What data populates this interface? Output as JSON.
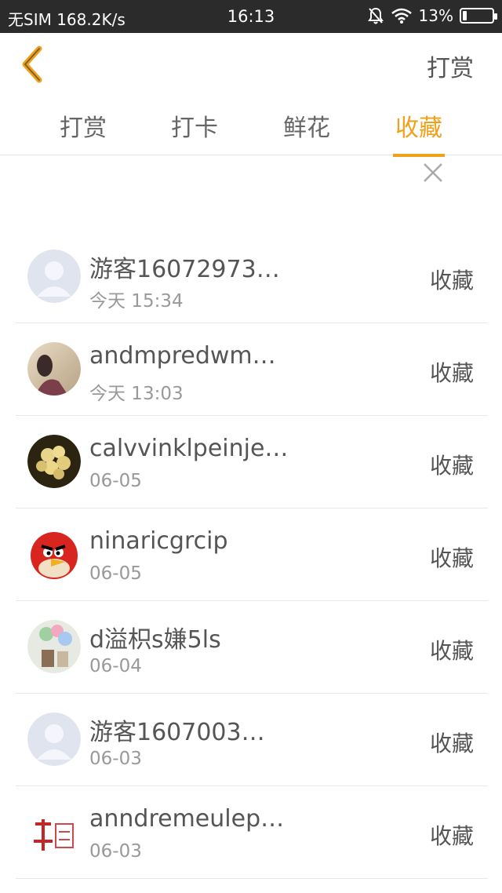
{
  "status_bar": {
    "carrier": "无SIM 168.2K/s",
    "time": "16:13",
    "battery_text": "13%",
    "battery_level": 0.13
  },
  "header": {
    "back_icon": "back-chevron-icon",
    "action_label": "打赏"
  },
  "tabs": [
    {
      "label": "打赏",
      "active": false
    },
    {
      "label": "打卡",
      "active": false
    },
    {
      "label": "鲜花",
      "active": false
    },
    {
      "label": "收藏",
      "active": true
    }
  ],
  "accent_color": "#f0a11c",
  "close_icon": "close-icon",
  "list": [
    {
      "name": "游客16072973…",
      "time": "今天 15:34",
      "action": "收藏",
      "avatar": "default-avatar"
    },
    {
      "name": "andmpredwm…",
      "time": "今天 13:03",
      "action": "收藏",
      "avatar": "photo-avatar"
    },
    {
      "name": "calvvinklpeinje…",
      "time": "06-05",
      "action": "收藏",
      "avatar": "flower-avatar"
    },
    {
      "name": "ninaricgrcip",
      "time": "06-05",
      "action": "收藏",
      "avatar": "angry-bird-avatar"
    },
    {
      "name": "d溢枳s嫌5ls",
      "time": "06-04",
      "action": "收藏",
      "avatar": "balloon-avatar"
    },
    {
      "name": "游客1607003…",
      "time": "06-03",
      "action": "收藏",
      "avatar": "default-avatar"
    },
    {
      "name": "anndremeulep…",
      "time": "06-03",
      "action": "收藏",
      "avatar": "logo-avatar"
    }
  ]
}
